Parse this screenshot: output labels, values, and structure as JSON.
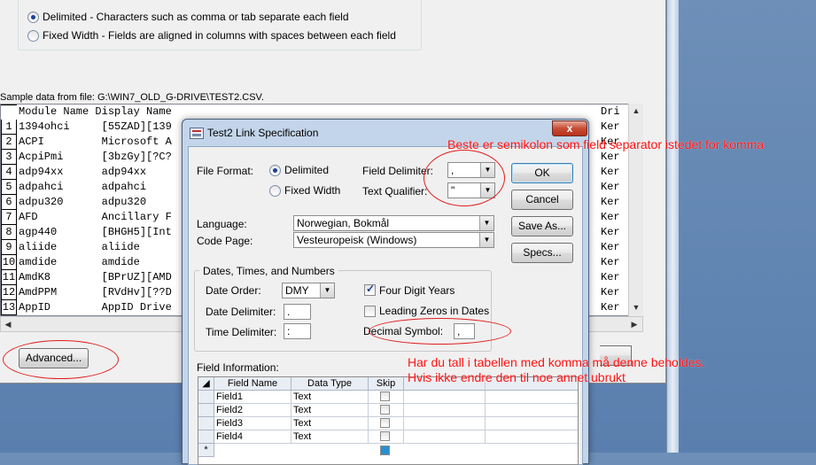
{
  "wizard": {
    "delimited_label": "Delimited - Characters such as comma or tab separate each field",
    "fixed_label": "Fixed Width - Fields are aligned in columns with spaces between each field",
    "sample_label": "Sample data from file: G:\\WIN7_OLD_G-DRIVE\\TEST2.CSV.",
    "sample_header": "Module Name Display Name",
    "sample_header_right": "Dri",
    "sample_rows": [
      {
        "num": "1",
        "text": "1394ohci     [55ZAD][139",
        "right": "Ker"
      },
      {
        "num": "2",
        "text": "ACPI         Microsoft A",
        "right": "Ker"
      },
      {
        "num": "3",
        "text": "AcpiPmi      [3bzGy][?C?",
        "right": "Ker"
      },
      {
        "num": "4",
        "text": "adp94xx      adp94xx",
        "right": "Ker"
      },
      {
        "num": "5",
        "text": "adpahci      adpahci",
        "right": "Ker"
      },
      {
        "num": "6",
        "text": "adpu320      adpu320",
        "right": "Ker"
      },
      {
        "num": "7",
        "text": "AFD          Ancillary F",
        "right": "Ker"
      },
      {
        "num": "8",
        "text": "agp440       [BHGH5][Int",
        "right": "Ker"
      },
      {
        "num": "9",
        "text": "aliide       aliide",
        "right": "Ker"
      },
      {
        "num": "10",
        "text": "amdide       amdide",
        "right": "Ker"
      },
      {
        "num": "11",
        "text": "AmdK8        [BPrUZ][AMD",
        "right": "Ker"
      },
      {
        "num": "12",
        "text": "AmdPPM       [RVdHv][??D",
        "right": "Ker"
      },
      {
        "num": "13",
        "text": "AppID        AppID Drive",
        "right": "Ker"
      }
    ],
    "advanced_button": "Advanced..."
  },
  "dialog": {
    "title": "Test2 Link Specification",
    "close": "x",
    "file_format_label": "File Format:",
    "delimited": "Delimited",
    "fixed_width": "Fixed Width",
    "field_delimiter_label": "Field Delimiter:",
    "field_delimiter_value": ",",
    "text_qualifier_label": "Text Qualifier:",
    "text_qualifier_value": "\"",
    "ok": "OK",
    "cancel": "Cancel",
    "save_as": "Save As...",
    "specs": "Specs...",
    "language_label": "Language:",
    "language_value": "Norwegian, Bokmål",
    "code_page_label": "Code Page:",
    "code_page_value": "Vesteuropeisk (Windows)",
    "dates_group": "Dates, Times, and Numbers",
    "date_order_label": "Date Order:",
    "date_order_value": "DMY",
    "date_delimiter_label": "Date Delimiter:",
    "date_delimiter_value": ".",
    "time_delimiter_label": "Time Delimiter:",
    "time_delimiter_value": ":",
    "four_digit_years": "Four Digit Years",
    "leading_zeros": "Leading Zeros in Dates",
    "decimal_symbol_label": "Decimal Symbol:",
    "decimal_symbol_value": ",",
    "field_info_label": "Field Information:",
    "grid_headers": [
      "Field Name",
      "Data Type",
      "Skip"
    ],
    "grid_rows": [
      {
        "name": "Field1",
        "type": "Text"
      },
      {
        "name": "Field2",
        "type": "Text"
      },
      {
        "name": "Field3",
        "type": "Text"
      },
      {
        "name": "Field4",
        "type": "Text"
      }
    ],
    "new_row_marker": "*"
  },
  "annotations": {
    "top": "Beste er semikolon som field separator istedet for komma",
    "bottom_line1": "Har du tall i tabellen med komma må denne beholdes.",
    "bottom_line2": "Hvis ikke endre den til noe annet ubrukt"
  },
  "colors": {
    "annotation": "#ff1010",
    "titlebar": "#c3d5ea"
  }
}
